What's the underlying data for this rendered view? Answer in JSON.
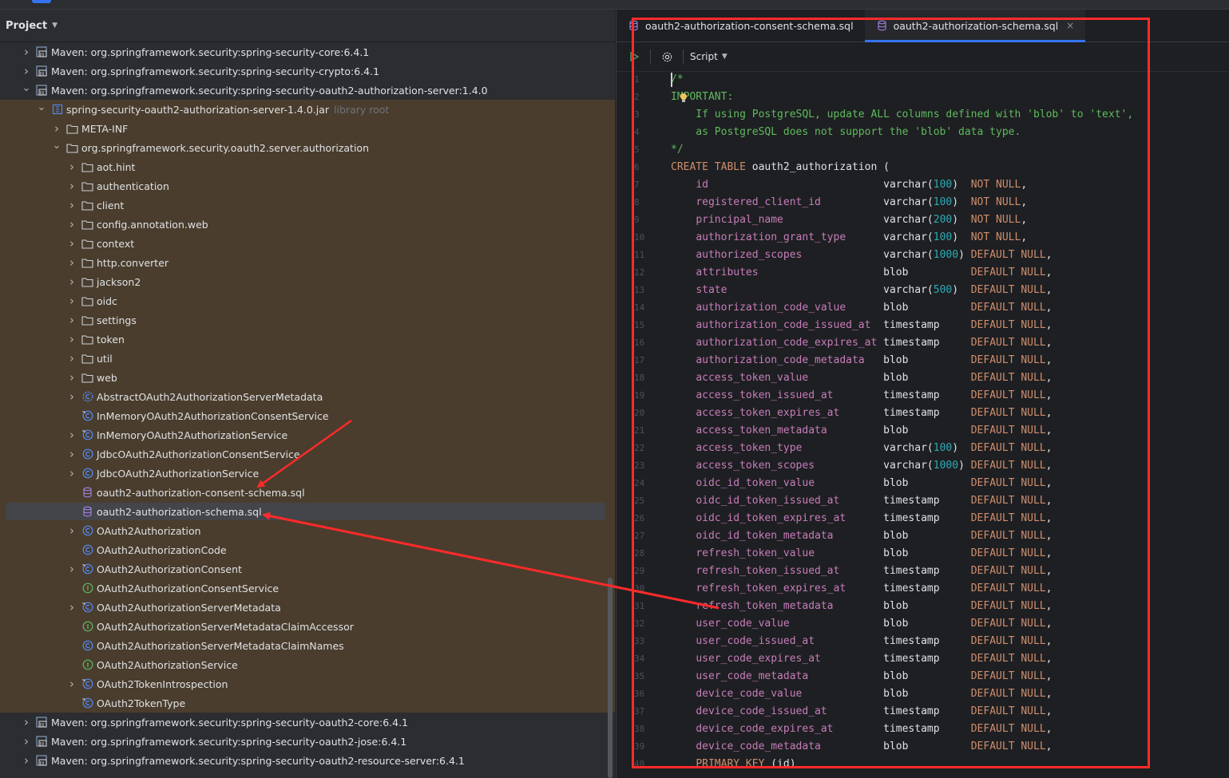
{
  "project_panel": {
    "title": "Project",
    "tree": [
      {
        "label": "Maven: org.springframework.security:spring-security-core:6.4.1",
        "indent": 0,
        "arrow": "right",
        "icon": "library-icon",
        "bg": "dark"
      },
      {
        "label": "Maven: org.springframework.security:spring-security-crypto:6.4.1",
        "indent": 0,
        "arrow": "right",
        "icon": "library-icon",
        "bg": "dark"
      },
      {
        "label": "Maven: org.springframework.security:spring-security-oauth2-authorization-server:1.4.0",
        "indent": 0,
        "arrow": "down",
        "icon": "library-icon",
        "bg": "dark"
      },
      {
        "label": "spring-security-oauth2-authorization-server-1.4.0.jar",
        "hint": "library root",
        "indent": 1,
        "arrow": "down",
        "icon": "jar-icon",
        "bg": "brown"
      },
      {
        "label": "META-INF",
        "indent": 2,
        "arrow": "right",
        "icon": "folder-icon",
        "bg": "brown"
      },
      {
        "label": "org.springframework.security.oauth2.server.authorization",
        "indent": 2,
        "arrow": "down",
        "icon": "folder-icon",
        "bg": "brown"
      },
      {
        "label": "aot.hint",
        "indent": 3,
        "arrow": "right",
        "icon": "folder-icon",
        "bg": "brown"
      },
      {
        "label": "authentication",
        "indent": 3,
        "arrow": "right",
        "icon": "folder-icon",
        "bg": "brown"
      },
      {
        "label": "client",
        "indent": 3,
        "arrow": "right",
        "icon": "folder-icon",
        "bg": "brown"
      },
      {
        "label": "config.annotation.web",
        "indent": 3,
        "arrow": "right",
        "icon": "folder-icon",
        "bg": "brown"
      },
      {
        "label": "context",
        "indent": 3,
        "arrow": "right",
        "icon": "folder-icon",
        "bg": "brown"
      },
      {
        "label": "http.converter",
        "indent": 3,
        "arrow": "right",
        "icon": "folder-icon",
        "bg": "brown"
      },
      {
        "label": "jackson2",
        "indent": 3,
        "arrow": "right",
        "icon": "folder-icon",
        "bg": "brown"
      },
      {
        "label": "oidc",
        "indent": 3,
        "arrow": "right",
        "icon": "folder-icon",
        "bg": "brown"
      },
      {
        "label": "settings",
        "indent": 3,
        "arrow": "right",
        "icon": "folder-icon",
        "bg": "brown"
      },
      {
        "label": "token",
        "indent": 3,
        "arrow": "right",
        "icon": "folder-icon",
        "bg": "brown"
      },
      {
        "label": "util",
        "indent": 3,
        "arrow": "right",
        "icon": "folder-icon",
        "bg": "brown"
      },
      {
        "label": "web",
        "indent": 3,
        "arrow": "right",
        "icon": "folder-icon",
        "bg": "brown"
      },
      {
        "label": "AbstractOAuth2AuthorizationServerMetadata",
        "indent": 3,
        "arrow": "right",
        "icon": "abstract-class-icon",
        "bg": "brown"
      },
      {
        "label": "InMemoryOAuth2AuthorizationConsentService",
        "indent": 3,
        "arrow": "none",
        "icon": "final-class-icon",
        "bg": "brown"
      },
      {
        "label": "InMemoryOAuth2AuthorizationService",
        "indent": 3,
        "arrow": "right",
        "icon": "final-class-icon",
        "bg": "brown"
      },
      {
        "label": "JdbcOAuth2AuthorizationConsentService",
        "indent": 3,
        "arrow": "right",
        "icon": "class-icon",
        "bg": "brown"
      },
      {
        "label": "JdbcOAuth2AuthorizationService",
        "indent": 3,
        "arrow": "right",
        "icon": "class-icon",
        "bg": "brown"
      },
      {
        "label": "oauth2-authorization-consent-schema.sql",
        "indent": 3,
        "arrow": "none",
        "icon": "sql-file-icon",
        "bg": "brown"
      },
      {
        "label": "oauth2-authorization-schema.sql",
        "indent": 3,
        "arrow": "none",
        "icon": "sql-file-icon",
        "bg": "brown",
        "selected": true
      },
      {
        "label": "OAuth2Authorization",
        "indent": 3,
        "arrow": "right",
        "icon": "class-icon",
        "bg": "brown"
      },
      {
        "label": "OAuth2AuthorizationCode",
        "indent": 3,
        "arrow": "none",
        "icon": "class-icon",
        "bg": "brown"
      },
      {
        "label": "OAuth2AuthorizationConsent",
        "indent": 3,
        "arrow": "right",
        "icon": "final-class-icon",
        "bg": "brown"
      },
      {
        "label": "OAuth2AuthorizationConsentService",
        "indent": 3,
        "arrow": "none",
        "icon": "interface-icon",
        "bg": "brown"
      },
      {
        "label": "OAuth2AuthorizationServerMetadata",
        "indent": 3,
        "arrow": "right",
        "icon": "final-class-icon",
        "bg": "brown"
      },
      {
        "label": "OAuth2AuthorizationServerMetadataClaimAccessor",
        "indent": 3,
        "arrow": "none",
        "icon": "interface-icon",
        "bg": "brown"
      },
      {
        "label": "OAuth2AuthorizationServerMetadataClaimNames",
        "indent": 3,
        "arrow": "none",
        "icon": "class-icon",
        "bg": "brown"
      },
      {
        "label": "OAuth2AuthorizationService",
        "indent": 3,
        "arrow": "none",
        "icon": "interface-icon",
        "bg": "brown"
      },
      {
        "label": "OAuth2TokenIntrospection",
        "indent": 3,
        "arrow": "right",
        "icon": "final-class-icon",
        "bg": "brown"
      },
      {
        "label": "OAuth2TokenType",
        "indent": 3,
        "arrow": "none",
        "icon": "final-class-icon",
        "bg": "brown"
      },
      {
        "label": "Maven: org.springframework.security:spring-security-oauth2-core:6.4.1",
        "indent": 0,
        "arrow": "right",
        "icon": "library-icon",
        "bg": "dark"
      },
      {
        "label": "Maven: org.springframework.security:spring-security-oauth2-jose:6.4.1",
        "indent": 0,
        "arrow": "right",
        "icon": "library-icon",
        "bg": "dark"
      },
      {
        "label": "Maven: org.springframework.security:spring-security-oauth2-resource-server:6.4.1",
        "indent": 0,
        "arrow": "right",
        "icon": "library-icon",
        "bg": "dark"
      }
    ]
  },
  "editor": {
    "tabs": [
      {
        "label": "oauth2-authorization-consent-schema.sql",
        "active": false
      },
      {
        "label": "oauth2-authorization-schema.sql",
        "active": true
      }
    ],
    "close_glyph": "×",
    "toolbar": {
      "script_label": "Script"
    },
    "line_numbers": [
      "1",
      "2",
      "3",
      "4",
      "5",
      "6",
      "7",
      "8",
      "9",
      "10",
      "11",
      "12",
      "13",
      "14",
      "15",
      "16",
      "17",
      "18",
      "19",
      "20",
      "21",
      "22",
      "23",
      "24",
      "25",
      "26",
      "27",
      "28",
      "29",
      "30",
      "31",
      "32",
      "33",
      "34",
      "35",
      "36",
      "37",
      "38",
      "39",
      "40"
    ],
    "comment_lines": [
      "/*",
      "IMPORTANT:",
      "    If using PostgreSQL, update ALL columns defined with 'blob' to 'text',",
      "    as PostgreSQL does not support the 'blob' data type.",
      "*/"
    ],
    "create_statement": {
      "keyword": "CREATE TABLE",
      "table": "oauth2_authorization",
      "open": " ("
    },
    "columns": [
      {
        "name": "id",
        "type": "varchar",
        "size": "100",
        "constraint": "NOT NULL",
        "end": ","
      },
      {
        "name": "registered_client_id",
        "type": "varchar",
        "size": "100",
        "constraint": "NOT NULL",
        "end": ","
      },
      {
        "name": "principal_name",
        "type": "varchar",
        "size": "200",
        "constraint": "NOT NULL",
        "end": ","
      },
      {
        "name": "authorization_grant_type",
        "type": "varchar",
        "size": "100",
        "constraint": "NOT NULL",
        "end": ","
      },
      {
        "name": "authorized_scopes",
        "type": "varchar",
        "size": "1000",
        "constraint": "DEFAULT NULL",
        "end": ","
      },
      {
        "name": "attributes",
        "type": "blob",
        "size": "",
        "constraint": "DEFAULT NULL",
        "end": ","
      },
      {
        "name": "state",
        "type": "varchar",
        "size": "500",
        "constraint": "DEFAULT NULL",
        "end": ","
      },
      {
        "name": "authorization_code_value",
        "type": "blob",
        "size": "",
        "constraint": "DEFAULT NULL",
        "end": ","
      },
      {
        "name": "authorization_code_issued_at",
        "type": "timestamp",
        "size": "",
        "constraint": "DEFAULT NULL",
        "end": ","
      },
      {
        "name": "authorization_code_expires_at",
        "type": "timestamp",
        "size": "",
        "constraint": "DEFAULT NULL",
        "end": ","
      },
      {
        "name": "authorization_code_metadata",
        "type": "blob",
        "size": "",
        "constraint": "DEFAULT NULL",
        "end": ","
      },
      {
        "name": "access_token_value",
        "type": "blob",
        "size": "",
        "constraint": "DEFAULT NULL",
        "end": ","
      },
      {
        "name": "access_token_issued_at",
        "type": "timestamp",
        "size": "",
        "constraint": "DEFAULT NULL",
        "end": ","
      },
      {
        "name": "access_token_expires_at",
        "type": "timestamp",
        "size": "",
        "constraint": "DEFAULT NULL",
        "end": ","
      },
      {
        "name": "access_token_metadata",
        "type": "blob",
        "size": "",
        "constraint": "DEFAULT NULL",
        "end": ","
      },
      {
        "name": "access_token_type",
        "type": "varchar",
        "size": "100",
        "constraint": "DEFAULT NULL",
        "end": ","
      },
      {
        "name": "access_token_scopes",
        "type": "varchar",
        "size": "1000",
        "constraint": "DEFAULT NULL",
        "end": ","
      },
      {
        "name": "oidc_id_token_value",
        "type": "blob",
        "size": "",
        "constraint": "DEFAULT NULL",
        "end": ","
      },
      {
        "name": "oidc_id_token_issued_at",
        "type": "timestamp",
        "size": "",
        "constraint": "DEFAULT NULL",
        "end": ","
      },
      {
        "name": "oidc_id_token_expires_at",
        "type": "timestamp",
        "size": "",
        "constraint": "DEFAULT NULL",
        "end": ","
      },
      {
        "name": "oidc_id_token_metadata",
        "type": "blob",
        "size": "",
        "constraint": "DEFAULT NULL",
        "end": ","
      },
      {
        "name": "refresh_token_value",
        "type": "blob",
        "size": "",
        "constraint": "DEFAULT NULL",
        "end": ","
      },
      {
        "name": "refresh_token_issued_at",
        "type": "timestamp",
        "size": "",
        "constraint": "DEFAULT NULL",
        "end": ","
      },
      {
        "name": "refresh_token_expires_at",
        "type": "timestamp",
        "size": "",
        "constraint": "DEFAULT NULL",
        "end": ","
      },
      {
        "name": "refresh_token_metadata",
        "type": "blob",
        "size": "",
        "constraint": "DEFAULT NULL",
        "end": ","
      },
      {
        "name": "user_code_value",
        "type": "blob",
        "size": "",
        "constraint": "DEFAULT NULL",
        "end": ","
      },
      {
        "name": "user_code_issued_at",
        "type": "timestamp",
        "size": "",
        "constraint": "DEFAULT NULL",
        "end": ","
      },
      {
        "name": "user_code_expires_at",
        "type": "timestamp",
        "size": "",
        "constraint": "DEFAULT NULL",
        "end": ","
      },
      {
        "name": "user_code_metadata",
        "type": "blob",
        "size": "",
        "constraint": "DEFAULT NULL",
        "end": ","
      },
      {
        "name": "device_code_value",
        "type": "blob",
        "size": "",
        "constraint": "DEFAULT NULL",
        "end": ","
      },
      {
        "name": "device_code_issued_at",
        "type": "timestamp",
        "size": "",
        "constraint": "DEFAULT NULL",
        "end": ","
      },
      {
        "name": "device_code_expires_at",
        "type": "timestamp",
        "size": "",
        "constraint": "DEFAULT NULL",
        "end": ","
      },
      {
        "name": "device_code_metadata",
        "type": "blob",
        "size": "",
        "constraint": "DEFAULT NULL",
        "end": ","
      }
    ],
    "primary_key": {
      "keyword": "PRIMARY KEY",
      "column": "(id)"
    }
  },
  "colors": {
    "annotation_red": "#ff2a2a",
    "accent_blue": "#3574f0",
    "tree_highlight": "#4a3d2d"
  }
}
